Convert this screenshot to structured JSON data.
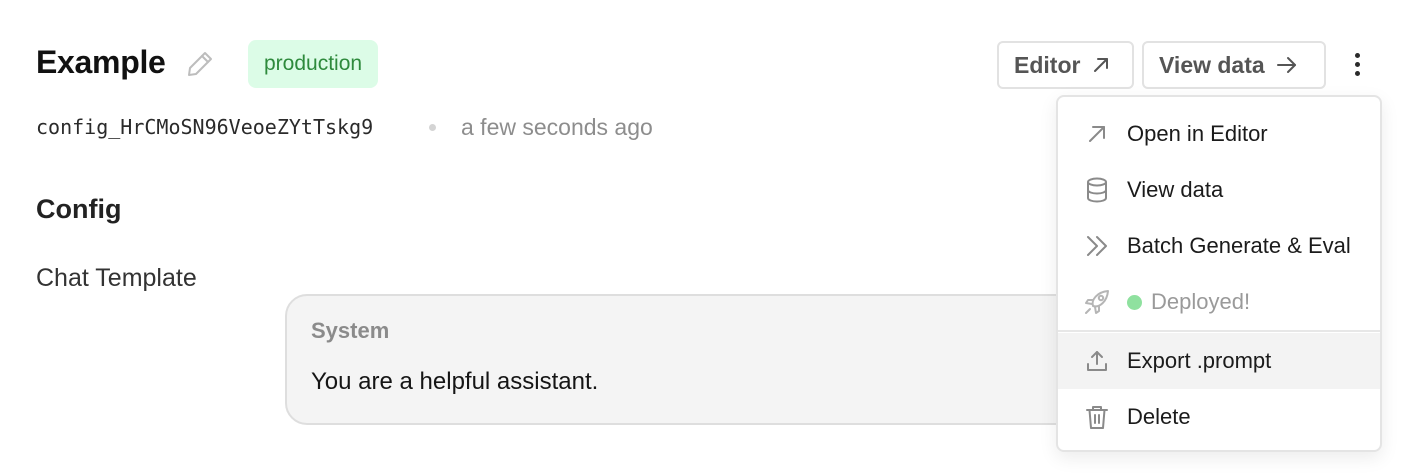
{
  "header": {
    "title": "Example",
    "badge": "production",
    "config_id": "config_HrCMoSN96VeoeZYtTskg9",
    "timestamp": "a few seconds ago"
  },
  "toolbar": {
    "editor_label": "Editor",
    "view_data_label": "View data"
  },
  "config": {
    "section_title": "Config",
    "chat_template_label": "Chat Template",
    "message": {
      "role": "System",
      "content": "You are a helpful assistant."
    }
  },
  "menu": {
    "items": [
      {
        "label": "Open in Editor",
        "icon": "arrow-up-right-icon"
      },
      {
        "label": "View data",
        "icon": "database-icon"
      },
      {
        "label": "Batch Generate & Eval",
        "icon": "chevrons-right-icon"
      },
      {
        "label": "Deployed!",
        "icon": "rocket-icon",
        "status_color": "#8fe19f"
      },
      {
        "label": "Export .prompt",
        "icon": "upload-icon"
      },
      {
        "label": "Delete",
        "icon": "trash-icon"
      }
    ]
  },
  "colors": {
    "badge_bg": "#dcfce7",
    "badge_text": "#2e8a3c",
    "deployed_dot": "#8fe19f"
  }
}
